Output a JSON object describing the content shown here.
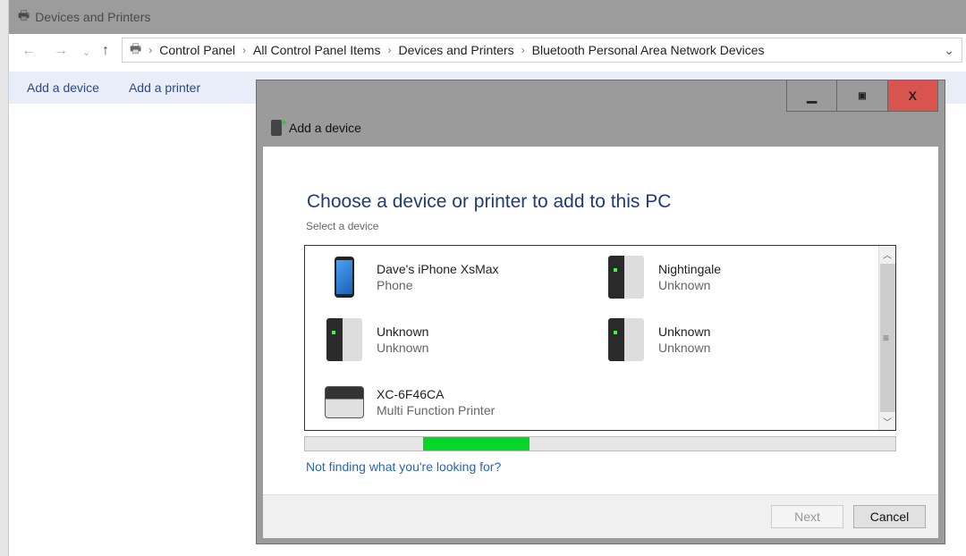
{
  "explorer": {
    "title": "Devices and Printers",
    "breadcrumb": [
      "Control Panel",
      "All Control Panel Items",
      "Devices and Printers",
      "Bluetooth Personal Area Network Devices"
    ],
    "commands": [
      "Add a device",
      "Add a printer"
    ]
  },
  "dialog": {
    "title": "Add a device",
    "heading": "Choose a device or printer to add to this PC",
    "subheading": "Select a device",
    "devices": [
      {
        "name": "Dave's iPhone XsMax",
        "type": "Phone",
        "icon": "phone-icon"
      },
      {
        "name": "Nightingale",
        "type": "Unknown",
        "icon": "computer-tower-icon"
      },
      {
        "name": "Unknown",
        "type": "Unknown",
        "icon": "computer-tower-icon"
      },
      {
        "name": "Unknown",
        "type": "Unknown",
        "icon": "computer-tower-icon"
      },
      {
        "name": "XC-6F46CA",
        "type": "Multi Function Printer",
        "icon": "printer-icon"
      }
    ],
    "progress": {
      "indeterminate": true,
      "segment_start_percent": 20,
      "segment_width_percent": 18,
      "color": "#06d626"
    },
    "help_link": "Not finding what you're looking for?",
    "next_label": "Next",
    "cancel_label": "Cancel",
    "close_color": "#d9534f"
  }
}
